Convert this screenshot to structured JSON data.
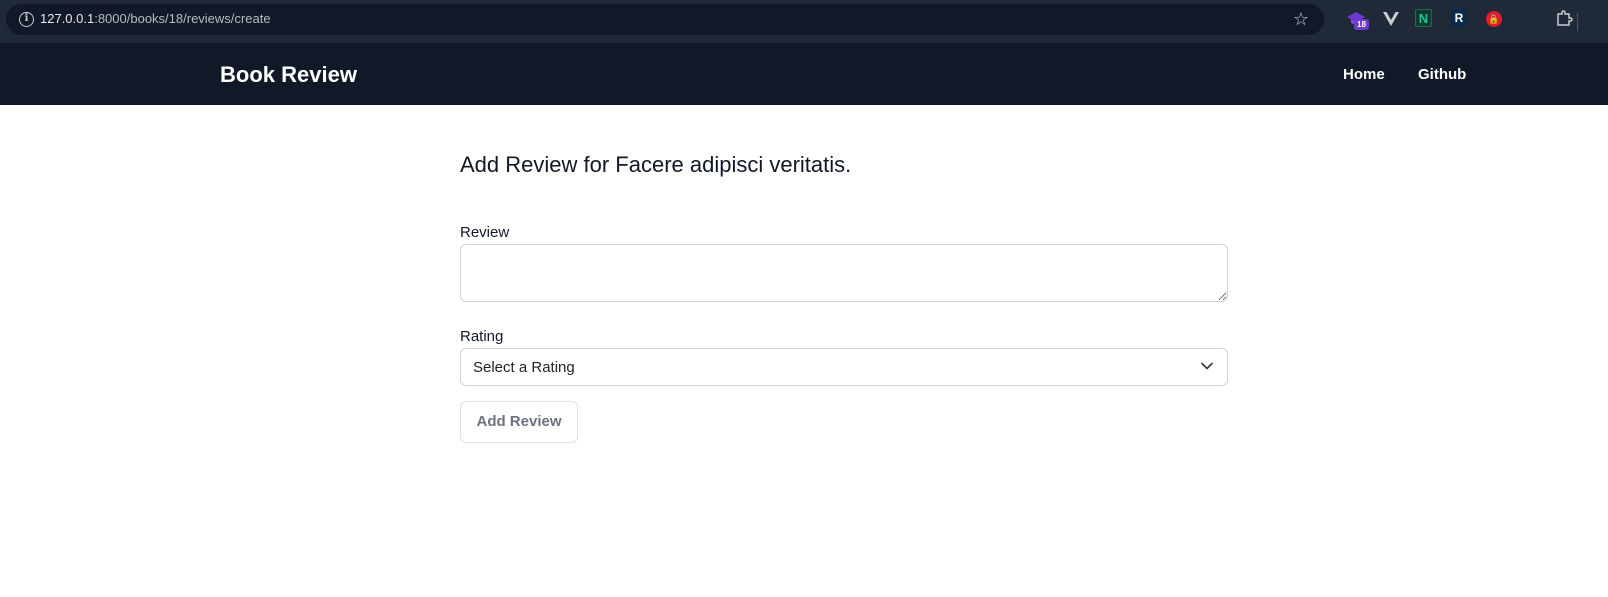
{
  "browser": {
    "url_host": "127.0.0.1",
    "url_rest": ":8000/books/18/reviews/create",
    "extension_badge": "18",
    "extension_n_letter": "N",
    "extension_r_letter": "R"
  },
  "navbar": {
    "brand": "Book Review",
    "links": [
      "Home",
      "Github"
    ]
  },
  "form": {
    "title": "Add Review for Facere adipisci veritatis.",
    "review_label": "Review",
    "review_value": "",
    "rating_label": "Rating",
    "rating_selected": "Select a Rating",
    "submit_label": "Add Review"
  }
}
